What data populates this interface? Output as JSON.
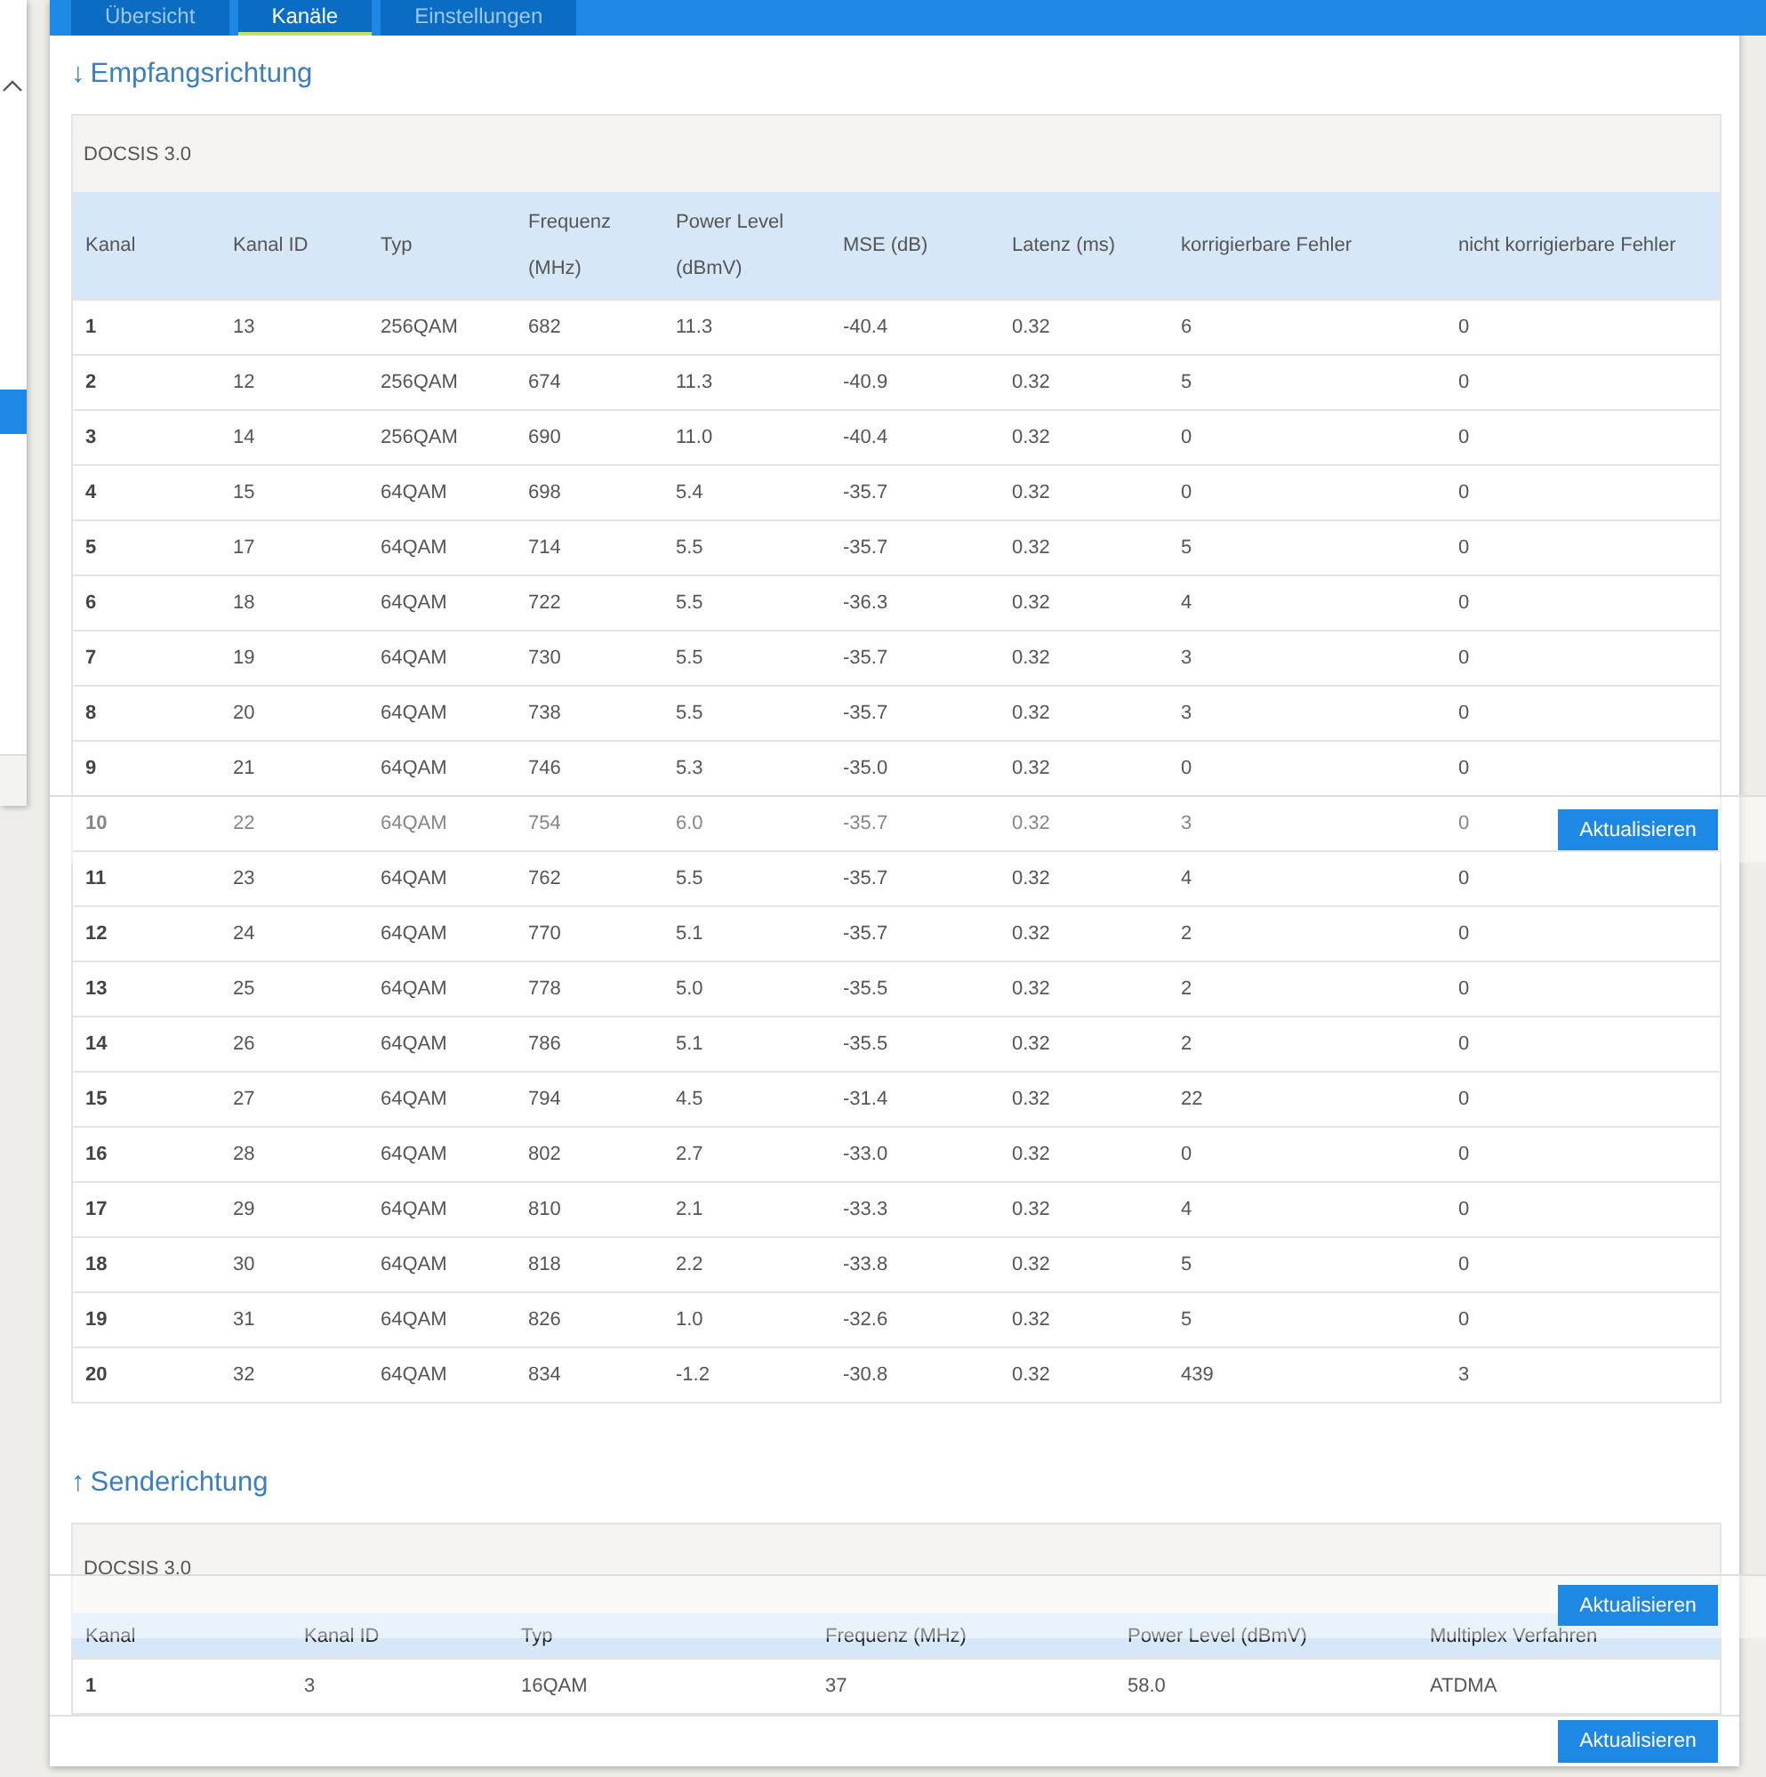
{
  "sidebar": {
    "expanded": true,
    "items": [
      {
        "selected": false
      },
      {
        "selected": true
      },
      {
        "selected": false
      }
    ]
  },
  "tabs": [
    {
      "label": "Übersicht",
      "selected": false
    },
    {
      "label": "Kanäle",
      "selected": true
    },
    {
      "label": "Einstellungen",
      "selected": false
    }
  ],
  "downstream": {
    "arrow": "↓",
    "title": "Empfangsrichtung",
    "standard": "DOCSIS 3.0",
    "sticky_button": "Aktualisieren",
    "header_faded": false,
    "columns": [
      "Kanal",
      "Kanal ID",
      "Typ",
      "Frequenz (MHz)",
      "Power Level (dBmV)",
      "MSE (dB)",
      "Latenz (ms)",
      "korrigierbare Fehler",
      "nicht korrigierbare Fehler"
    ],
    "rows": [
      {
        "faded": false,
        "cells": [
          "1",
          "13",
          "256QAM",
          "682",
          "11.3",
          "-40.4",
          "0.32",
          "6",
          "0"
        ]
      },
      {
        "faded": false,
        "cells": [
          "2",
          "12",
          "256QAM",
          "674",
          "11.3",
          "-40.9",
          "0.32",
          "5",
          "0"
        ]
      },
      {
        "faded": false,
        "cells": [
          "3",
          "14",
          "256QAM",
          "690",
          "11.0",
          "-40.4",
          "0.32",
          "0",
          "0"
        ]
      },
      {
        "faded": false,
        "cells": [
          "4",
          "15",
          "64QAM",
          "698",
          "5.4",
          "-35.7",
          "0.32",
          "0",
          "0"
        ]
      },
      {
        "faded": false,
        "cells": [
          "5",
          "17",
          "64QAM",
          "714",
          "5.5",
          "-35.7",
          "0.32",
          "5",
          "0"
        ]
      },
      {
        "faded": false,
        "cells": [
          "6",
          "18",
          "64QAM",
          "722",
          "5.5",
          "-36.3",
          "0.32",
          "4",
          "0"
        ]
      },
      {
        "faded": false,
        "cells": [
          "7",
          "19",
          "64QAM",
          "730",
          "5.5",
          "-35.7",
          "0.32",
          "3",
          "0"
        ]
      },
      {
        "faded": false,
        "cells": [
          "8",
          "20",
          "64QAM",
          "738",
          "5.5",
          "-35.7",
          "0.32",
          "3",
          "0"
        ]
      },
      {
        "faded": false,
        "cells": [
          "9",
          "21",
          "64QAM",
          "746",
          "5.3",
          "-35.0",
          "0.32",
          "0",
          "0"
        ]
      },
      {
        "faded": true,
        "cells": [
          "10",
          "22",
          "64QAM",
          "754",
          "6.0",
          "-35.7",
          "0.32",
          "3",
          "0"
        ]
      },
      {
        "faded": false,
        "cells": [
          "11",
          "23",
          "64QAM",
          "762",
          "5.5",
          "-35.7",
          "0.32",
          "4",
          "0"
        ]
      },
      {
        "faded": false,
        "cells": [
          "12",
          "24",
          "64QAM",
          "770",
          "5.1",
          "-35.7",
          "0.32",
          "2",
          "0"
        ]
      },
      {
        "faded": false,
        "cells": [
          "13",
          "25",
          "64QAM",
          "778",
          "5.0",
          "-35.5",
          "0.32",
          "2",
          "0"
        ]
      },
      {
        "faded": false,
        "cells": [
          "14",
          "26",
          "64QAM",
          "786",
          "5.1",
          "-35.5",
          "0.32",
          "2",
          "0"
        ]
      },
      {
        "faded": false,
        "cells": [
          "15",
          "27",
          "64QAM",
          "794",
          "4.5",
          "-31.4",
          "0.32",
          "22",
          "0"
        ]
      },
      {
        "faded": false,
        "cells": [
          "16",
          "28",
          "64QAM",
          "802",
          "2.7",
          "-33.0",
          "0.32",
          "0",
          "0"
        ]
      },
      {
        "faded": false,
        "cells": [
          "17",
          "29",
          "64QAM",
          "810",
          "2.1",
          "-33.3",
          "0.32",
          "4",
          "0"
        ]
      },
      {
        "faded": false,
        "cells": [
          "18",
          "30",
          "64QAM",
          "818",
          "2.2",
          "-33.8",
          "0.32",
          "5",
          "0"
        ]
      },
      {
        "faded": false,
        "cells": [
          "19",
          "31",
          "64QAM",
          "826",
          "1.0",
          "-32.6",
          "0.32",
          "5",
          "0"
        ]
      },
      {
        "faded": false,
        "cells": [
          "20",
          "32",
          "64QAM",
          "834",
          "-1.2",
          "-30.8",
          "0.32",
          "439",
          "3"
        ]
      }
    ]
  },
  "upstream": {
    "arrow": "↑",
    "title": "Senderichtung",
    "standard": "DOCSIS 3.0",
    "sticky_button": "Aktualisieren",
    "header_faded": true,
    "columns": [
      "Kanal",
      "Kanal ID",
      "Typ",
      "Frequenz (MHz)",
      "Power Level (dBmV)",
      "Multiplex Verfahren"
    ],
    "rows": [
      {
        "faded": false,
        "cells": [
          "1",
          "3",
          "16QAM",
          "37",
          "58.0",
          "ATDMA"
        ]
      }
    ]
  },
  "footer_button": "Aktualisieren"
}
